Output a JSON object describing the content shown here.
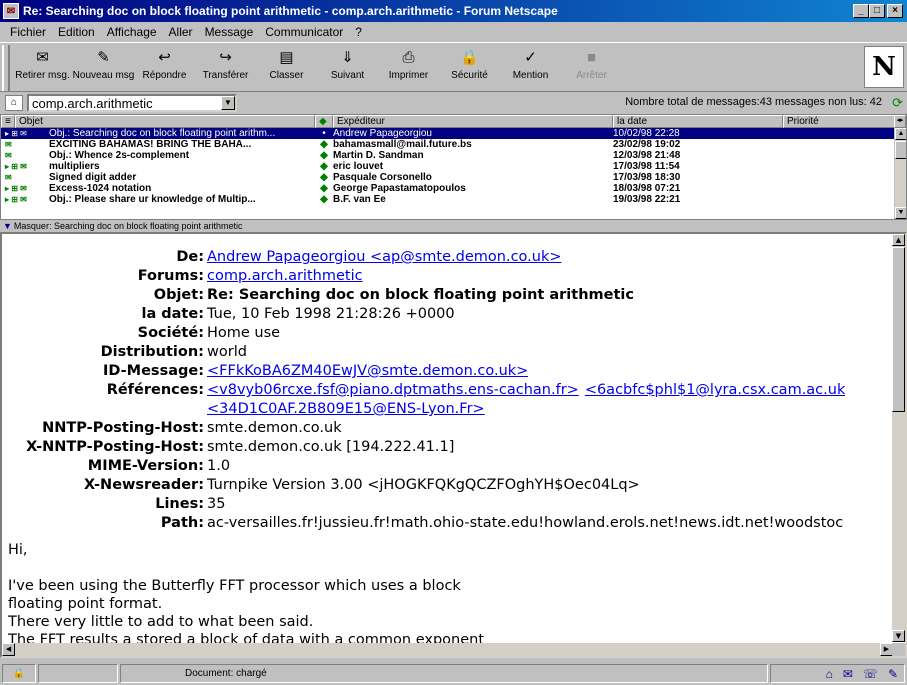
{
  "window": {
    "title": "Re: Searching doc on block floating point arithmetic - comp.arch.arithmetic - Forum Netscape",
    "controls": {
      "minimize": "_",
      "maximize": "□",
      "close": "×"
    }
  },
  "menu": [
    "Fichier",
    "Edition",
    "Affichage",
    "Aller",
    "Message",
    "Communicator",
    "?"
  ],
  "toolbar": {
    "buttons": [
      {
        "label": "Retirer msg.",
        "icon": "get-messages-icon",
        "glyph": "✉"
      },
      {
        "label": "Nouveau msg",
        "icon": "new-message-icon",
        "glyph": "✎"
      },
      {
        "label": "Répondre",
        "icon": "reply-icon",
        "glyph": "↩"
      },
      {
        "label": "Transférer",
        "icon": "forward-icon",
        "glyph": "↪"
      },
      {
        "label": "Classer",
        "icon": "file-icon",
        "glyph": "▤"
      },
      {
        "label": "Suivant",
        "icon": "next-icon",
        "glyph": "⇓"
      },
      {
        "label": "Imprimer",
        "icon": "print-icon",
        "glyph": "⎙"
      },
      {
        "label": "Sécurité",
        "icon": "security-lock-icon",
        "glyph": "🔒"
      },
      {
        "label": "Mention",
        "icon": "mark-icon",
        "glyph": "✓"
      },
      {
        "label": "Arrêter",
        "icon": "stop-icon",
        "glyph": "■",
        "disabled": true
      }
    ],
    "logo": "N"
  },
  "location": {
    "folder": "comp.arch.arithmetic",
    "message_count": "Nombre total de messages:43 messages non lus: 42"
  },
  "table": {
    "columns": [
      "Objet",
      "Expéditeur",
      "la date",
      "Priorité"
    ],
    "rows": [
      {
        "icons": "▸ ⊞ ✉",
        "subject": "Obj.: Searching doc on block floating point arithm...",
        "sender": "Andrew Papageorgiou",
        "date": "10/02/98 22:28",
        "selected": true
      },
      {
        "icons": "  ✉",
        "subject": "EXCITING BAHAMAS! BRING THE BAHA...",
        "sender": "bahamasmall@mail.future.bs",
        "date": "23/02/98 19:02"
      },
      {
        "icons": "  ✉",
        "subject": "Obj.: Whence 2s-complement",
        "sender": "Martin D. Sandman",
        "date": "12/03/98 21:48"
      },
      {
        "icons": "▸ ⊞ ✉",
        "subject": "multipliers",
        "sender": "eric louvet",
        "date": "17/03/98 11:54"
      },
      {
        "icons": "  ✉",
        "subject": "Signed digit adder",
        "sender": "Pasquale Corsonello",
        "date": "17/03/98 18:30"
      },
      {
        "icons": "▸ ⊞ ✉",
        "subject": "Excess-1024 notation",
        "sender": "George Papastamatopoulos",
        "date": "18/03/98 07:21"
      },
      {
        "icons": "▸ ⊞ ✉",
        "subject": "Obj.: Please share ur knowledge of Multip...",
        "sender": "B.F. van Ee",
        "date": "19/03/98 22:21"
      }
    ]
  },
  "hide_bar": "Masquer: Searching doc on block floating point arithmetic",
  "message": {
    "headers": [
      {
        "label": "De:",
        "value": "Andrew Papageorgiou <ap@smte.demon.co.uk>",
        "link": true
      },
      {
        "label": "Forums:",
        "value": "comp.arch.arithmetic",
        "link": true
      },
      {
        "label": "Objet:",
        "value": "Re: Searching doc on block floating point arithmetic",
        "bold": true
      },
      {
        "label": "la date:",
        "value": "Tue, 10 Feb 1998 21:28:26 +0000"
      },
      {
        "label": "Société:",
        "value": "Home use"
      },
      {
        "label": "Distribution:",
        "value": "world"
      },
      {
        "label": "ID-Message:",
        "value": "<FFkKoBA6ZM40EwJV@smte.demon.co.uk>",
        "link": true
      },
      {
        "label": "Références:",
        "value": "<v8vyb06rcxe.fsf@piano.dptmaths.ens-cachan.fr>",
        "value2": "<6acbfc$phl$1@lyra.csx.cam.ac.uk",
        "link": true
      },
      {
        "label": "",
        "value": "<34D1C0AF.2B809E15@ENS-Lyon.Fr>",
        "link": true
      },
      {
        "label": "NNTP-Posting-Host:",
        "value": "smte.demon.co.uk"
      },
      {
        "label": "X-NNTP-Posting-Host:",
        "value": "smte.demon.co.uk [194.222.41.1]"
      },
      {
        "label": "MIME-Version:",
        "value": "1.0"
      },
      {
        "label": "X-Newsreader:",
        "value": "Turnpike Version 3.00 <jHOGKFQKgQCZFOghYH$Oec04Lq>"
      },
      {
        "label": "Lines:",
        "value": "35"
      },
      {
        "label": "Path:",
        "value": "ac-versailles.fr!jussieu.fr!math.ohio-state.edu!howland.erols.net!news.idt.net!woodstoc"
      }
    ],
    "body": "Hi,\n\nI've been using the Butterfly FFT processor which uses a block\nfloating point format.\nThere very little to add to what been said.\nThe FFT results a stored a block of data with a common exponent"
  },
  "status": {
    "text": "Document: chargé"
  }
}
